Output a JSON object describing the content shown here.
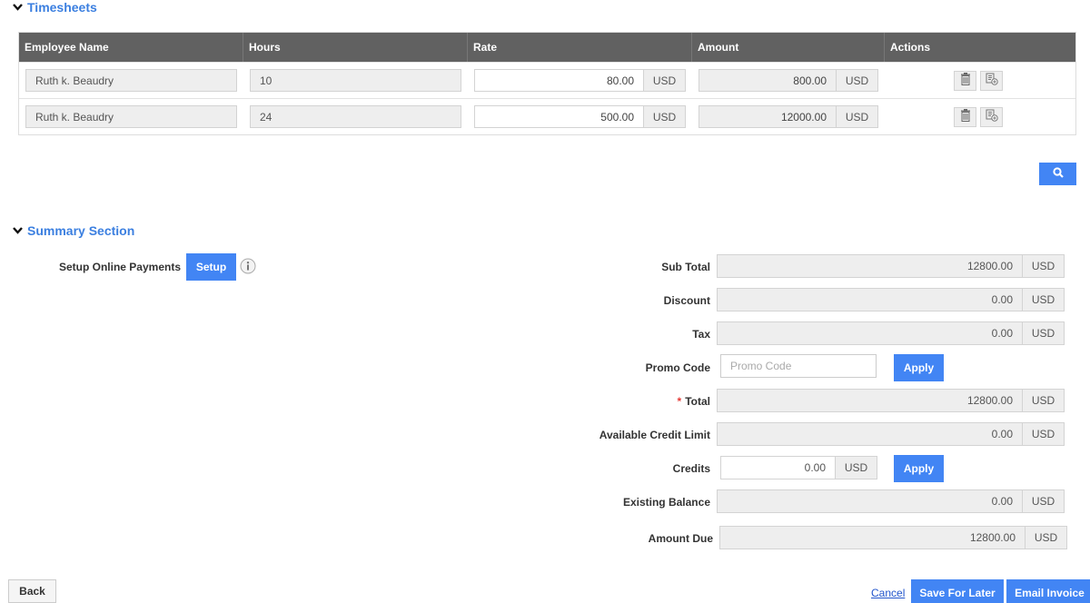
{
  "timesheets": {
    "title": "Timesheets",
    "columns": [
      "Employee Name",
      "Hours",
      "Rate",
      "Amount",
      "Actions"
    ],
    "rows": [
      {
        "employee": "Ruth k. Beaudry",
        "hours": "10",
        "rate": "80.00",
        "rate_currency": "USD",
        "amount": "800.00",
        "amount_currency": "USD"
      },
      {
        "employee": "Ruth k. Beaudry",
        "hours": "24",
        "rate": "500.00",
        "rate_currency": "USD",
        "amount": "12000.00",
        "amount_currency": "USD"
      }
    ],
    "actions": {
      "delete_icon": "trash-icon",
      "add_icon": "add-entry-icon"
    },
    "search_icon": "search-icon"
  },
  "summary": {
    "title": "Summary Section",
    "setup_online_payments_label": "Setup Online Payments",
    "setup_button": "Setup",
    "info_icon": "info-icon",
    "sub_total": {
      "label": "Sub Total",
      "value": "12800.00",
      "currency": "USD"
    },
    "discount": {
      "label": "Discount",
      "value": "0.00",
      "currency": "USD"
    },
    "tax": {
      "label": "Tax",
      "value": "0.00",
      "currency": "USD"
    },
    "promo_code": {
      "label": "Promo Code",
      "placeholder": "Promo Code",
      "value": "",
      "apply": "Apply"
    },
    "total": {
      "required_mark": "*",
      "label": "Total",
      "value": "12800.00",
      "currency": "USD"
    },
    "available_credit_limit": {
      "label": "Available Credit Limit",
      "value": "0.00",
      "currency": "USD"
    },
    "credits": {
      "label": "Credits",
      "value": "0.00",
      "currency": "USD",
      "apply": "Apply"
    },
    "existing_balance": {
      "label": "Existing Balance",
      "value": "0.00",
      "currency": "USD"
    },
    "amount_due": {
      "label": "Amount Due",
      "value": "12800.00",
      "currency": "USD"
    }
  },
  "footer": {
    "back": "Back",
    "cancel": "Cancel",
    "save_for_later": "Save For Later",
    "email_invoice": "Email Invoice"
  },
  "colors": {
    "accent": "#4285f4",
    "section_title": "#3b7fe0",
    "table_header": "#616161"
  }
}
